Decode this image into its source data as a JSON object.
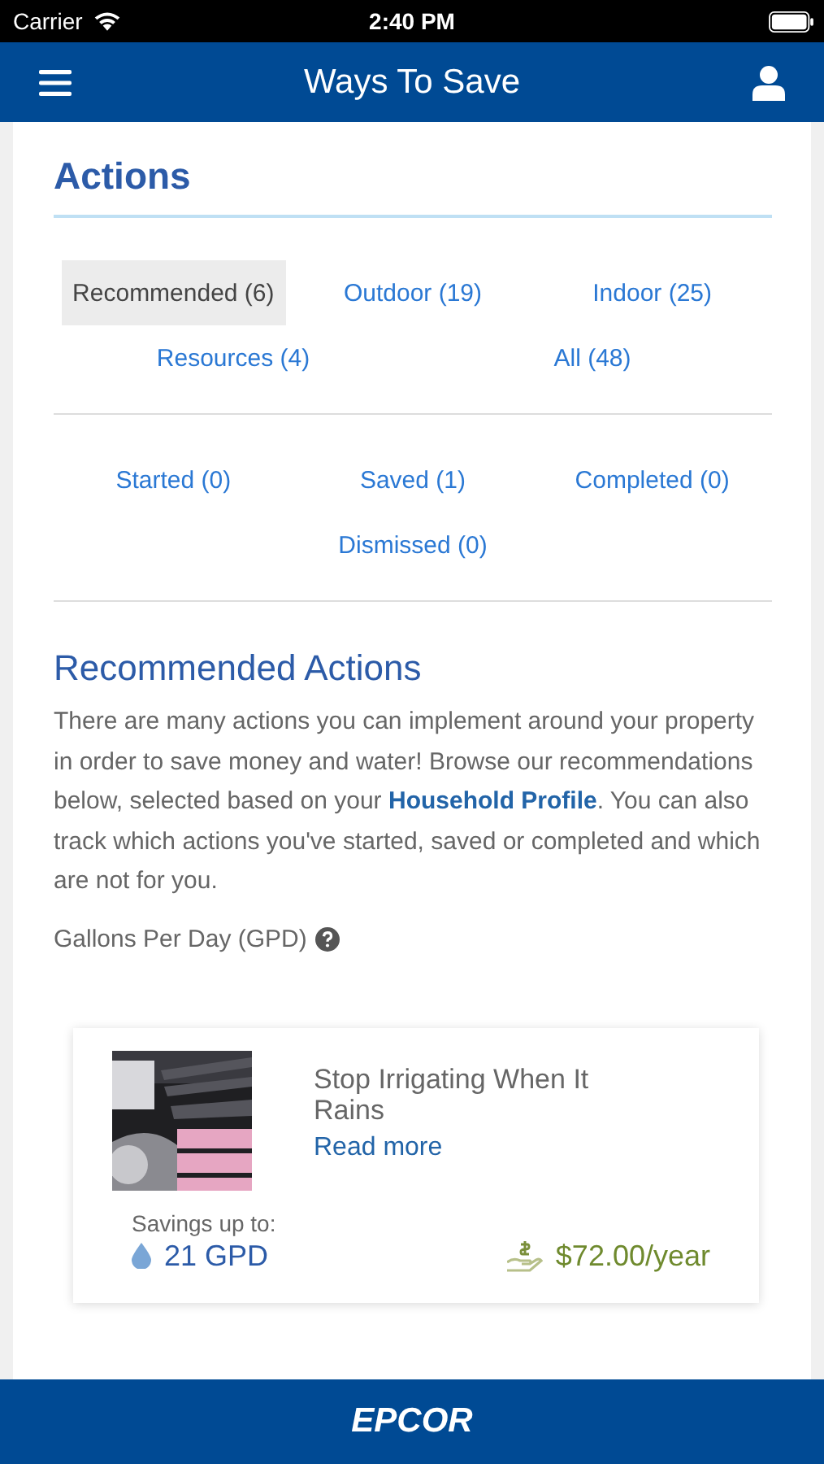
{
  "status_bar": {
    "carrier": "Carrier",
    "time": "2:40 PM"
  },
  "header": {
    "title": "Ways To Save"
  },
  "section_title": "Actions",
  "category_tabs": [
    {
      "label": "Recommended (6)",
      "selected": true
    },
    {
      "label": "Outdoor (19)",
      "selected": false
    },
    {
      "label": "Indoor (25)",
      "selected": false
    },
    {
      "label": "Resources (4)",
      "selected": false
    },
    {
      "label": "All (48)",
      "selected": false
    }
  ],
  "status_tabs": [
    {
      "label": "Started (0)",
      "selected": false
    },
    {
      "label": "Saved (1)",
      "selected": false
    },
    {
      "label": "Completed (0)",
      "selected": false
    },
    {
      "label": "Dismissed (0)",
      "selected": false
    }
  ],
  "recommended": {
    "heading": "Recommended Actions",
    "intro_before": "There are many actions you can implement around your property in order to save money and water! Browse our recommendations below, selected based on your ",
    "intro_link": "Household Profile",
    "intro_after": ". You can also track which actions you've started, saved or completed and which are not for you.",
    "unit_label": "Gallons Per Day (GPD)"
  },
  "action_card": {
    "title": "Stop Irrigating When It Rains",
    "link": "Read more",
    "savings_label": "Savings up to:",
    "water": "21 GPD",
    "money": "$72.00/year"
  },
  "footer": {
    "logo": "EPCOR"
  }
}
